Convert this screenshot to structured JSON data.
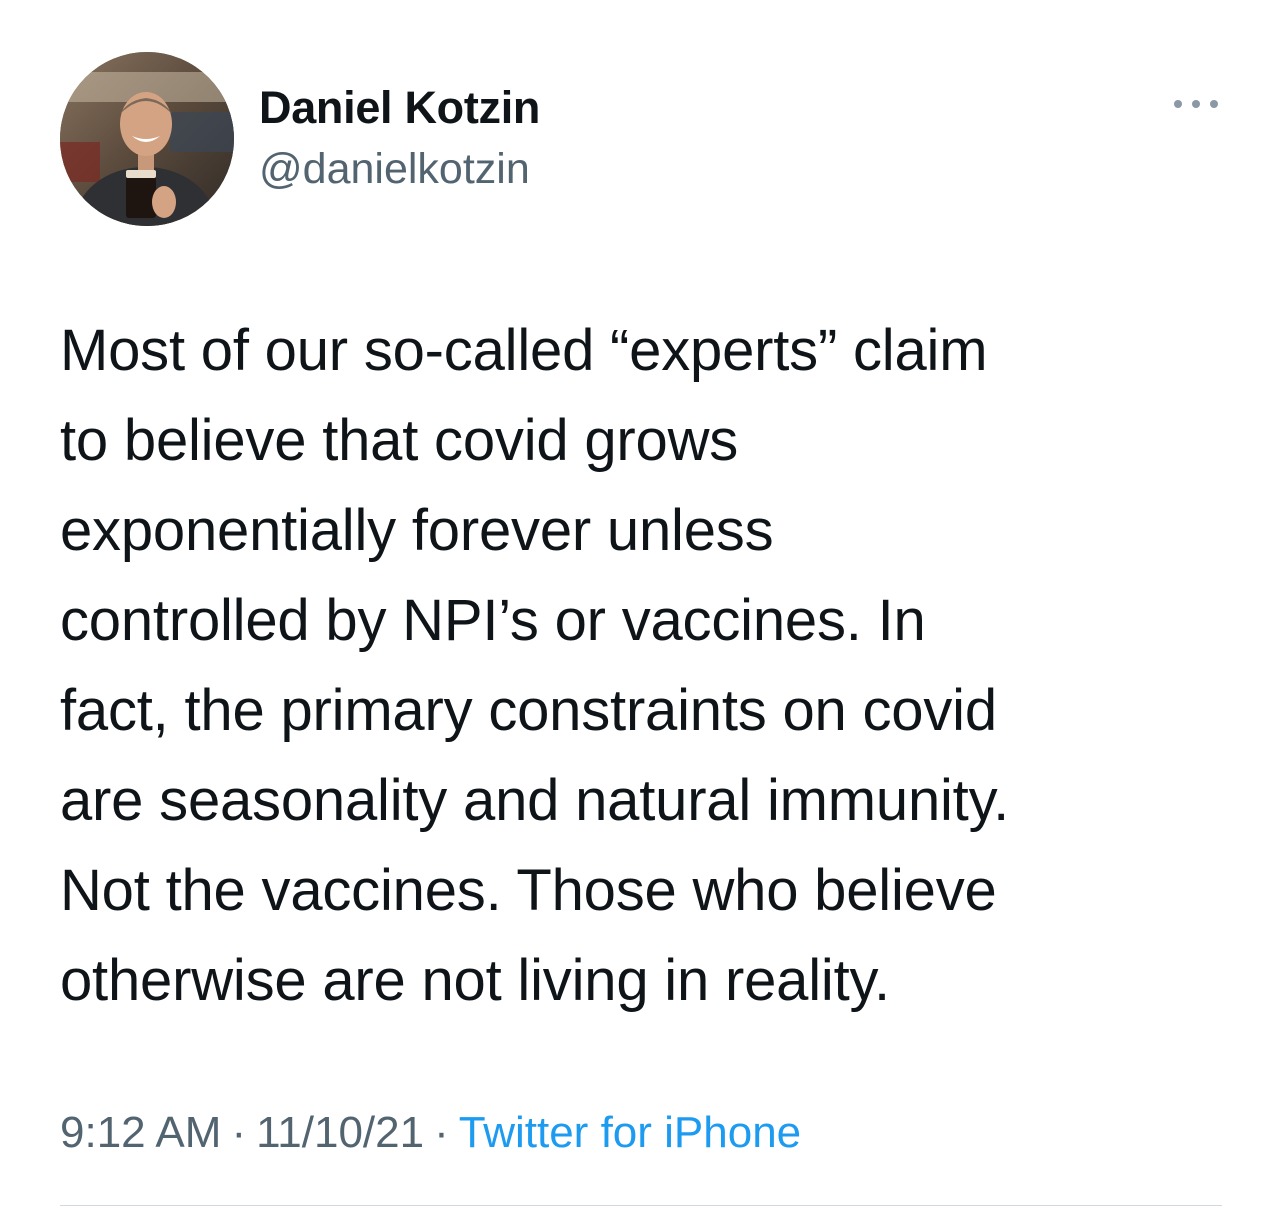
{
  "author": {
    "name": "Daniel Kotzin",
    "handle": "@danielkotzin",
    "avatar_icon": "profile-photo-icon"
  },
  "more_icon": "more-horizontal-icon",
  "tweet": {
    "lines": [
      "Most of our so-called “experts” claim",
      "to believe that covid grows",
      "exponentially forever unless",
      "controlled by NPI’s or vaccines. In",
      "fact, the primary constraints on covid",
      "are seasonality and natural immunity.",
      "Not the vaccines. Those who believe",
      "otherwise are not living in reality."
    ]
  },
  "meta": {
    "time": "9:12 AM",
    "separator": "·",
    "date": "11/10/21",
    "source": "Twitter for iPhone"
  },
  "colors": {
    "text": "#0f1419",
    "secondary": "#536471",
    "link": "#1d9bf0",
    "divider": "#cfd9de"
  }
}
